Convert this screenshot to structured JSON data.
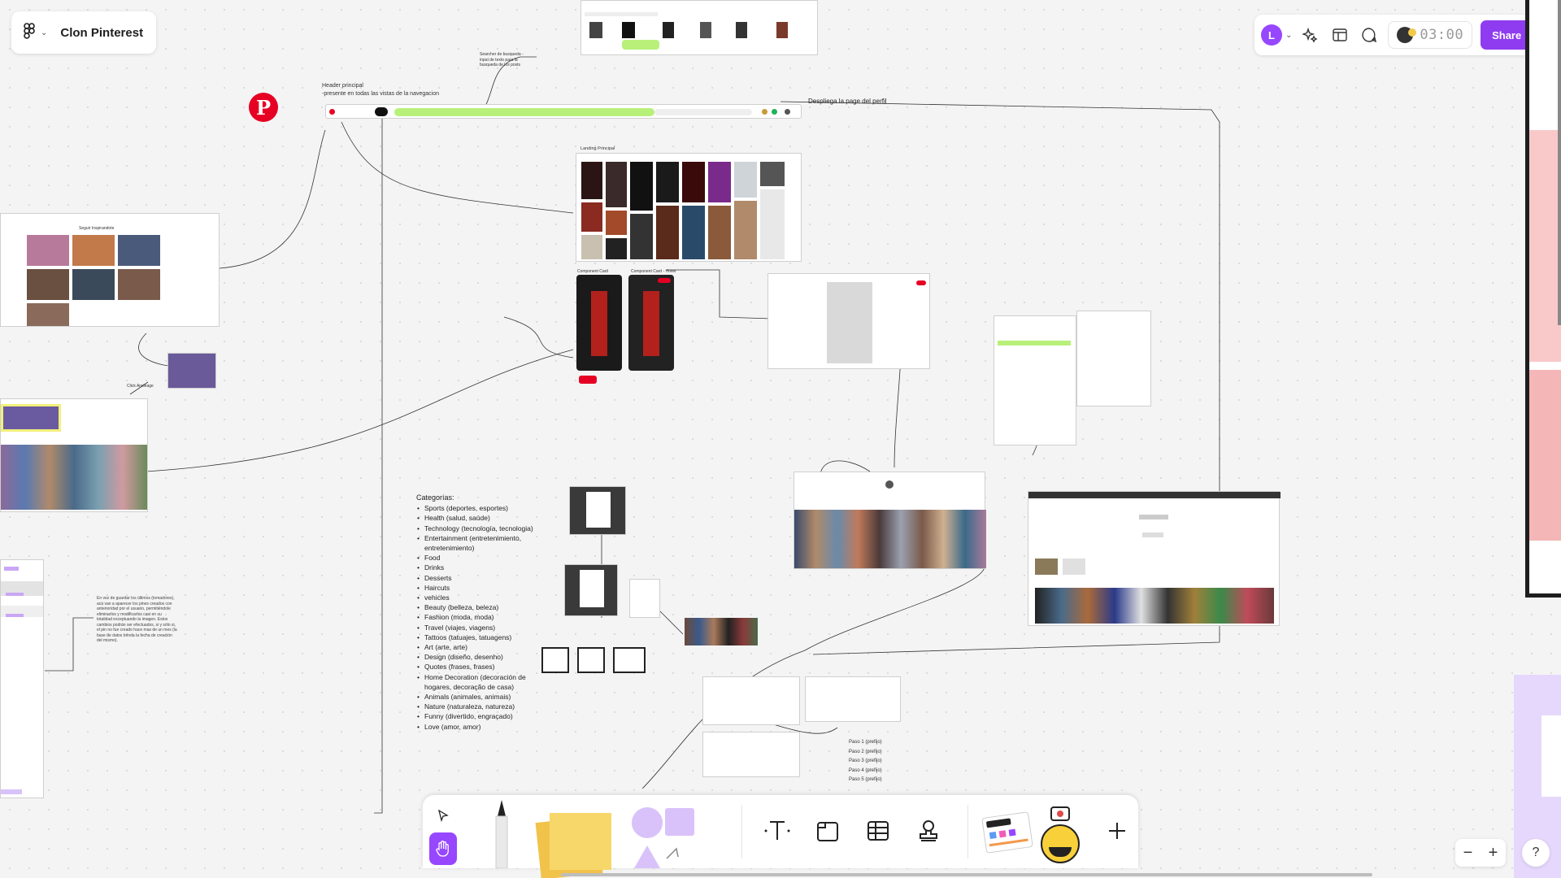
{
  "file": {
    "name": "Clon Pinterest"
  },
  "topbar": {
    "avatar_letter": "L",
    "timer": "03:00",
    "share_label": "Share",
    "accent": "#8f3cf0"
  },
  "canvas": {
    "header_label_1": "Header principal",
    "header_label_2": "-presente en todas las vistas de la navegacion",
    "profile_label": "Despliega la page del perfil",
    "searcher_note": "Searcher de busqueda -input de texto para la busqueda de los posts",
    "landing_label": "Landing Principal",
    "component_card": "Component Card",
    "component_card_hover": "Component Card - Hover",
    "board_title": "Seguir Inspirandote",
    "click_label": "Click Ancleage"
  },
  "categories": {
    "title": "Categorías:",
    "items": [
      "Sports (deportes, esportes)",
      "Health (salud, saúde)",
      "Technology (tecnología, tecnologia)",
      "Entertainment (entretenimiento, entretenimiento)",
      "Food",
      "Drinks",
      "Desserts",
      "Haircuts",
      "vehicles",
      "Beauty (belleza, beleza)",
      "Fashion (moda, moda)",
      "Travel (viajes, viagens)",
      "Tattoos (tatuajes, tatuagens)",
      "Art (arte, arte)",
      "Design (diseño, desenho)",
      "Quotes (frases, frases)",
      "Home Decoration (decoración de hogares, decoração de casa)",
      "Animals (animales, animais)",
      "Nature (naturaleza, natureza)",
      "Funny (divertido, engraçado)",
      "Love (amor, amor)"
    ]
  },
  "pasos": [
    "Paso 1 (prefijo)",
    "Paso 2 (prefijo)",
    "Paso 3 (prefijo)",
    "Paso 4 (prefijo)",
    "Paso 5 (prefijo)"
  ],
  "side_note": "En vez de guardar los últimos (tomadores), acá van a aparecer los pines creados con anterioridad por el usuario, permitiéndole eliminarlos y modificarlos casi en su totalidad exceptuando la imagen. Estos cambios podrán ser efectuados, si y sólo si, el pin no fue creado hace mas de un mes (la base de datos brinda la fecha de creación del mismo).",
  "toolbar": {
    "tools": [
      "select-tool",
      "hand-tool",
      "pen-tool",
      "sticky-note-tool",
      "shapes-tool",
      "text-tool",
      "section-tool",
      "table-tool",
      "stamp-tool",
      "jambot-widget",
      "add-tool"
    ]
  },
  "zoom": {
    "minus": "−",
    "plus": "+"
  },
  "help": "?"
}
